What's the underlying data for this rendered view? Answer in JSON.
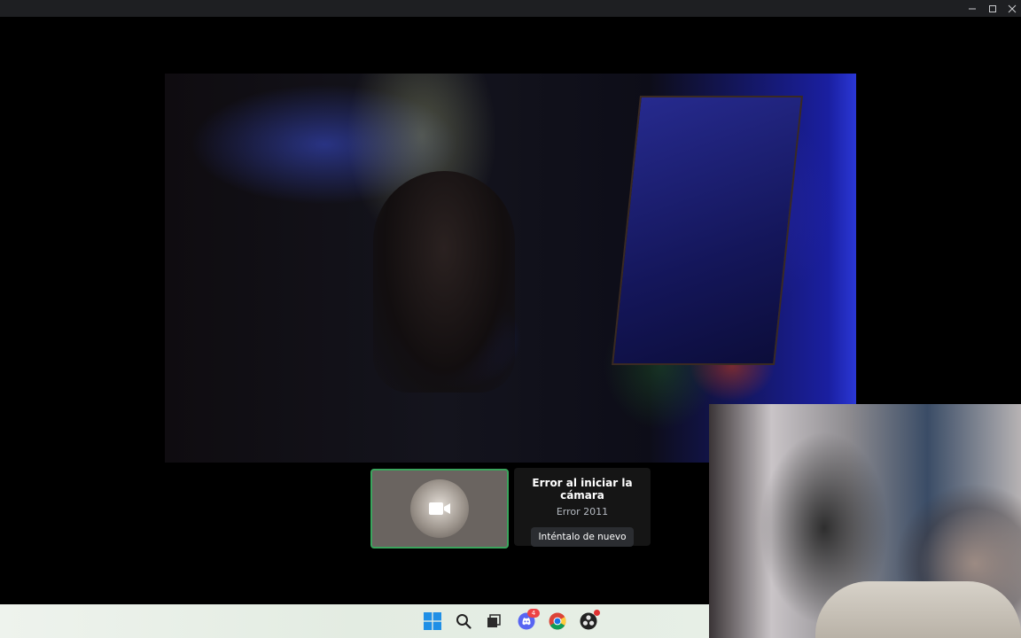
{
  "window": {
    "controls": [
      "minimize",
      "maximize",
      "close"
    ]
  },
  "call": {
    "camera_error": {
      "title": "Error al iniciar la cámara",
      "code": "Error 2011",
      "retry_label": "Inténtalo de nuevo"
    },
    "self_tile": {
      "icon": "video-camera-icon",
      "border_color": "#3ba55d"
    }
  },
  "taskbar": {
    "icons": [
      "windows-start-icon",
      "search-icon",
      "task-view-icon",
      "discord-icon",
      "chrome-icon",
      "obs-icon"
    ],
    "discord_badge": "4"
  },
  "colors": {
    "speaking_border": "#3ba55d",
    "panel_bg": "#151515",
    "button_bg": "#2b2d31",
    "badge": "#ed4245"
  }
}
